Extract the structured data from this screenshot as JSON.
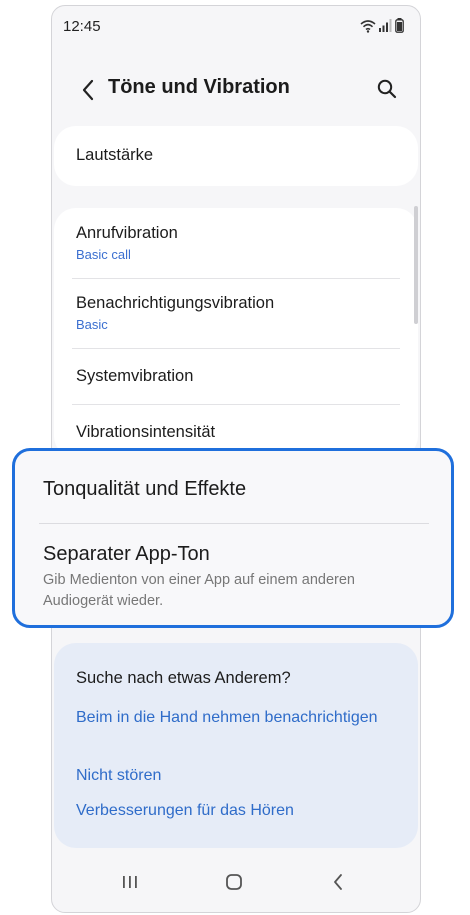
{
  "status_bar": {
    "time": "12:45"
  },
  "header": {
    "title": "Töne und Vibration"
  },
  "sections": {
    "volume": {
      "label": "Lautstärke"
    },
    "vibration": {
      "items": [
        {
          "label": "Anrufvibration",
          "sub": "Basic call"
        },
        {
          "label": "Benachrichtigungsvibration",
          "sub": "Basic"
        },
        {
          "label": "Systemvibration"
        },
        {
          "label": "Vibrationsintensität"
        }
      ]
    }
  },
  "highlight": {
    "sound_quality": "Tonqualität und Effekte",
    "separate_app_sound": "Separater App-Ton",
    "separate_app_sound_desc": "Gib Medienton von einer App auf einem anderen Audiogerät wieder.",
    "accent": "#1f6fdc"
  },
  "suggestions": {
    "heading": "Suche nach etwas Anderem?",
    "links": [
      "Beim in die Hand nehmen benachrichtigen",
      "Nicht stören",
      "Verbesserungen für das Hören"
    ]
  },
  "icons": {
    "back": "chevron-left-icon",
    "search": "search-icon",
    "wifi": "wifi-icon",
    "signal": "signal-icon",
    "battery": "battery-icon",
    "recent": "recent-apps-icon",
    "home": "home-icon",
    "nav_back": "back-icon"
  }
}
